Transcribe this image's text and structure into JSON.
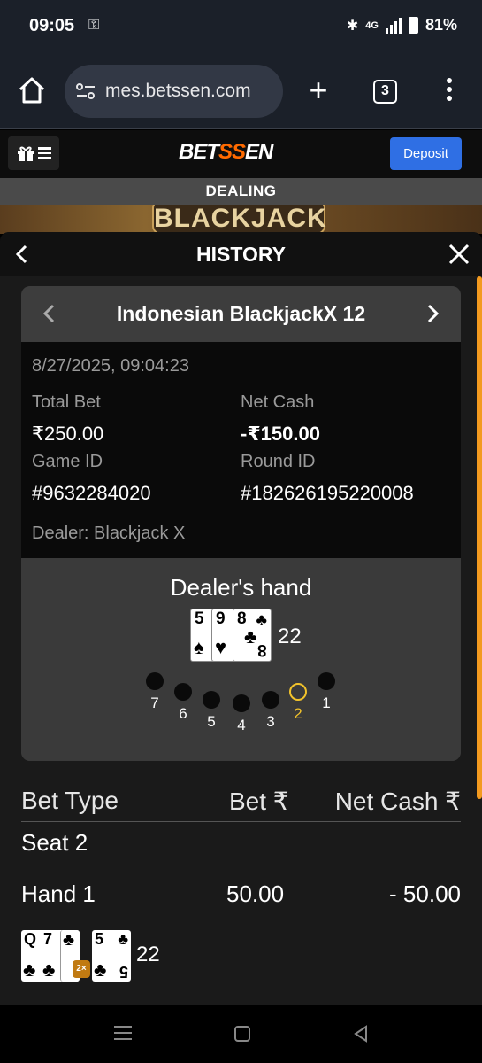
{
  "status": {
    "time": "09:05",
    "network": "4G",
    "battery": "81%"
  },
  "browser": {
    "url": "mes.betssen.com",
    "tab_count": "3"
  },
  "site": {
    "logo_pre": "BET",
    "logo_acc": "SS",
    "logo_post": "EN",
    "deposit": "Deposit",
    "dealing": "DEALING",
    "table_name": "BLACKJACK"
  },
  "history": {
    "title": "HISTORY",
    "game_name": "Indonesian BlackjackX 12",
    "datetime": "8/27/2025, 09:04:23",
    "total_bet_label": "Total Bet",
    "total_bet": "₹250.00",
    "net_cash_label": "Net Cash",
    "net_cash": "-₹150.00",
    "game_id_label": "Game ID",
    "game_id": "#9632284020",
    "round_id_label": "Round ID",
    "round_id": "#182626195220008",
    "dealer": "Dealer: Blackjack X",
    "dealers_hand_label": "Dealer's hand",
    "dealer_cards": [
      {
        "rank": "5",
        "suit": "♠"
      },
      {
        "rank": "9",
        "suit": "♥"
      },
      {
        "rank": "8",
        "suit": "♣"
      }
    ],
    "dealer_total": "22",
    "seats": [
      "7",
      "6",
      "5",
      "4",
      "3",
      "2",
      "1"
    ],
    "active_seat": "2",
    "table": {
      "col_bet_type": "Bet Type",
      "col_bet": "Bet ₹",
      "col_net": "Net Cash ₹",
      "seat_label": "Seat 2",
      "hand_label": "Hand 1",
      "hand_bet": "50.00",
      "hand_net": "- 50.00",
      "hand_cards": [
        {
          "rank": "Q",
          "suit": "♣"
        },
        {
          "rank": "7",
          "suit": "♣"
        },
        {
          "rank": "5",
          "suit": "♣"
        }
      ],
      "double_badge": "2×",
      "hand_total": "22"
    }
  },
  "colors": {
    "accent": "#f39a1f",
    "deposit": "#2f6fe4",
    "active_seat": "#f2c32b"
  }
}
